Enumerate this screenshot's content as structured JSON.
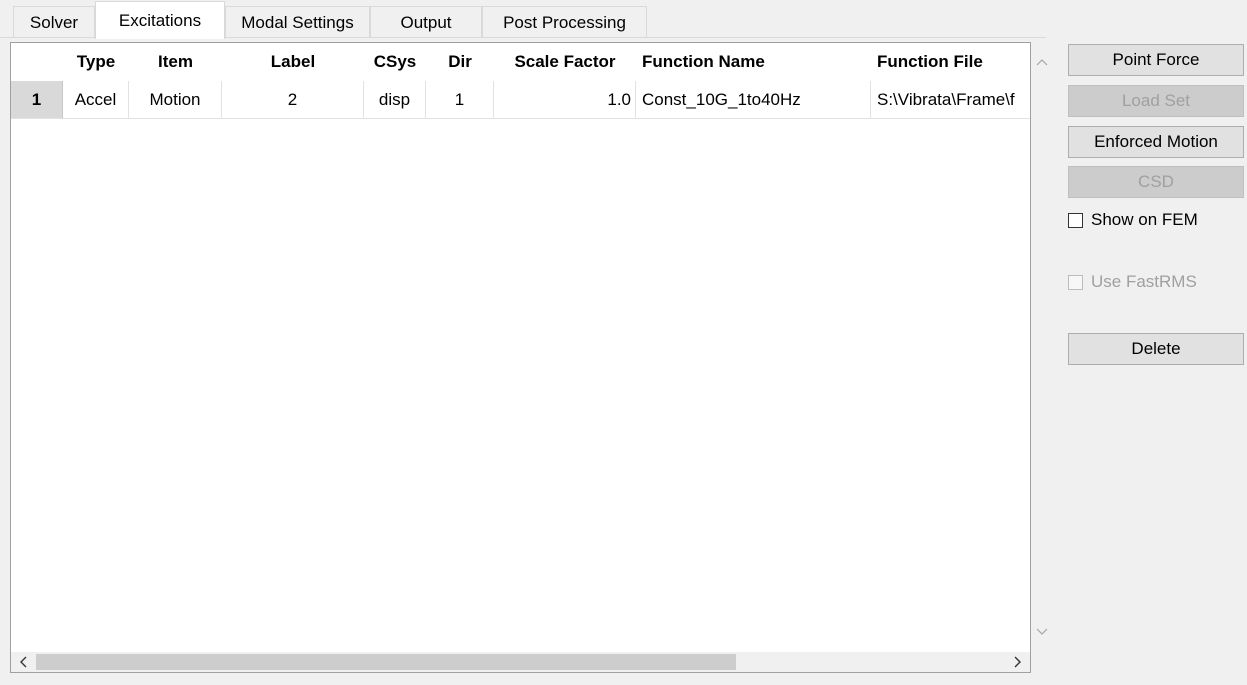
{
  "tabs": [
    {
      "label": "Solver"
    },
    {
      "label": "Excitations",
      "active": true
    },
    {
      "label": "Modal Settings"
    },
    {
      "label": "Output"
    },
    {
      "label": "Post Processing"
    }
  ],
  "table": {
    "columns": [
      "Type",
      "Item",
      "Label",
      "CSys",
      "Dir",
      "Scale Factor",
      "Function Name",
      "Function File"
    ],
    "rows": [
      {
        "num": "1",
        "type": "Accel",
        "item": "Motion",
        "label": "2",
        "csys": "disp",
        "dir": "1",
        "scale_factor": "1.0",
        "function_name": "Const_10G_1to40Hz",
        "function_file": "S:\\Vibrata\\Frame\\f"
      }
    ]
  },
  "buttons": {
    "point_force": "Point Force",
    "load_set": "Load Set",
    "enforced_motion": "Enforced Motion",
    "csd": "CSD",
    "delete": "Delete"
  },
  "checkboxes": {
    "show_on_fem": {
      "label": "Show on FEM",
      "checked": false
    },
    "use_fastrms": {
      "label": "Use FastRMS",
      "checked": false,
      "disabled": true
    }
  },
  "icons": {
    "scroll_up": "chevron-up-icon",
    "scroll_down": "chevron-down-icon",
    "scroll_left": "chevron-left-icon",
    "scroll_right": "chevron-right-icon"
  }
}
